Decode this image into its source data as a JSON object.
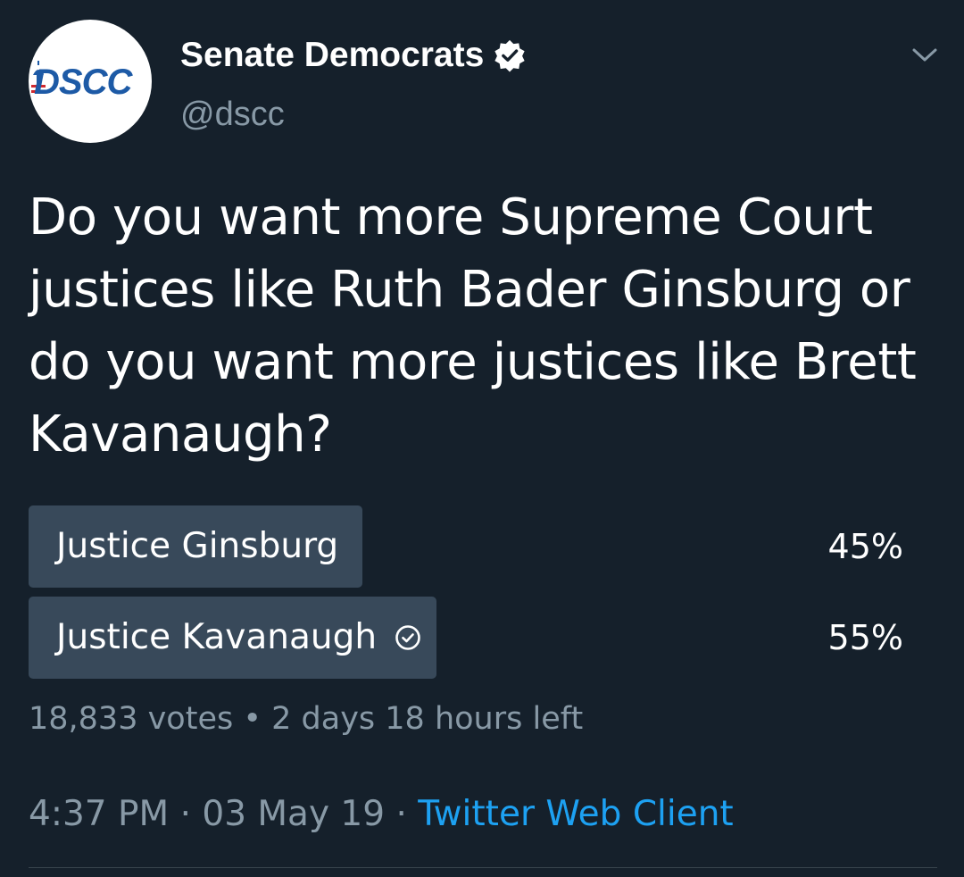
{
  "author": {
    "display_name": "Senate Democrats",
    "handle": "@dscc",
    "avatar_text": "DSCC",
    "verified": true
  },
  "tweet": {
    "text": "Do you want more Supreme Court justices like Ruth Bader Ginsburg or do you want more justices like Brett Kavanaugh?"
  },
  "poll": {
    "options": [
      {
        "label": "Justice Ginsburg",
        "percent_label": "45%",
        "percent": 45,
        "selected": false
      },
      {
        "label": "Justice Kavanaugh",
        "percent_label": "55%",
        "percent": 55,
        "selected": true
      }
    ],
    "votes": "18,833 votes",
    "separator": "•",
    "time_left": "2 days 18 hours left"
  },
  "footer": {
    "time": "4:37 PM",
    "date": "03 May 19",
    "separator": "·",
    "source": "Twitter Web Client"
  },
  "colors": {
    "background": "#15202b",
    "poll_fill": "#38495a",
    "muted_text": "#8899a6",
    "link": "#1da1f2",
    "brand_blue": "#1d5aa6",
    "brand_red": "#d0282e"
  },
  "icons": {
    "verified": "verified-badge-icon",
    "chevron": "chevron-down-icon",
    "poll_selected": "check-circle-icon"
  }
}
